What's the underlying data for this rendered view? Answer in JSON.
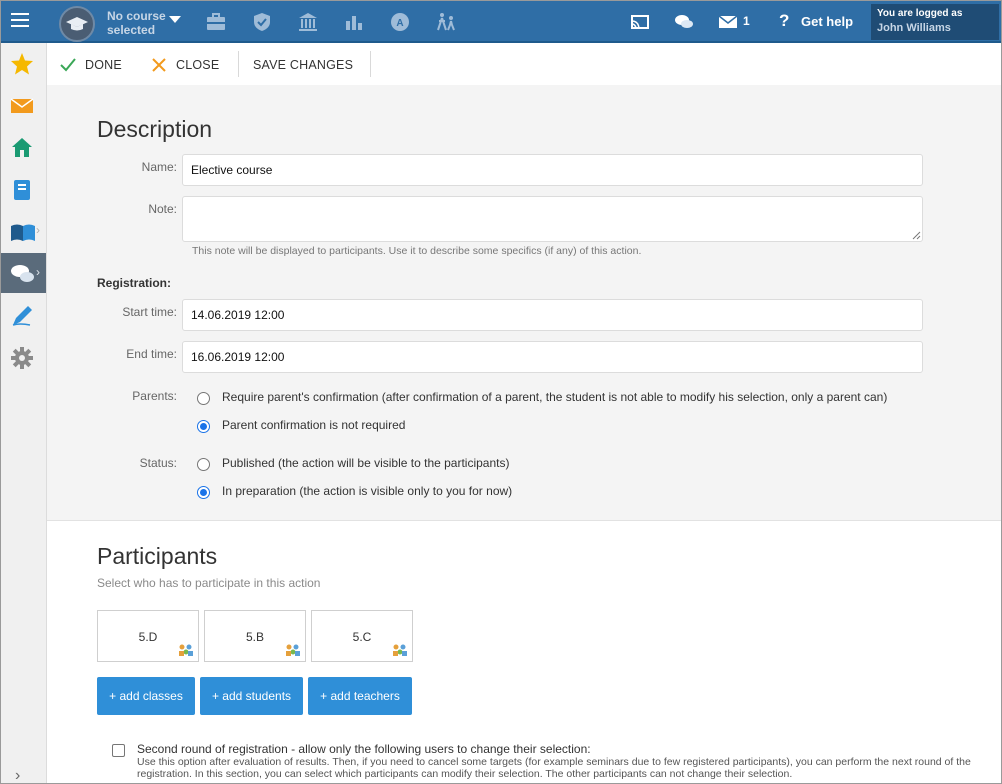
{
  "topbar": {
    "course_line1": "No course",
    "course_line2": "selected",
    "message_count": "1",
    "help_label": "Get help",
    "logged_in_label": "You are logged as",
    "user_name": "John Williams",
    "nav_icons": [
      "briefcase-icon",
      "shield-icon",
      "institution-icon",
      "bar-chart-icon",
      "award-icon",
      "walking-people-icon"
    ],
    "colors": {
      "bar": "#2f6ea6",
      "login_box": "#1f4c75"
    }
  },
  "sidebar": {
    "items": [
      "star-icon",
      "envelope-icon",
      "home-icon",
      "notebook-icon",
      "open-book-icon",
      "chat-icon",
      "pen-icon",
      "gear-icon"
    ]
  },
  "toolbar": {
    "done_label": "DONE",
    "close_label": "CLOSE",
    "save_label": "SAVE CHANGES"
  },
  "description": {
    "title": "Description",
    "name_label": "Name:",
    "name_value": "Elective course",
    "note_label": "Note:",
    "note_value": "",
    "note_hint": "This note will be displayed to participants. Use it to describe some specifics (if any) of this action.",
    "registration_label": "Registration:",
    "start_label": "Start time:",
    "start_value": "14.06.2019 12:00",
    "end_label": "End time:",
    "end_value": "16.06.2019 12:00",
    "parents_label": "Parents:",
    "parents_options": [
      {
        "label": "Require parent's confirmation (after confirmation of a parent, the student is not able to modify his selection, only a parent can)",
        "checked": false
      },
      {
        "label": "Parent confirmation is not required",
        "checked": true
      }
    ],
    "status_label": "Status:",
    "status_options": [
      {
        "label": "Published (the action will be visible to the participants)",
        "checked": false
      },
      {
        "label": "In preparation (the action is visible only to you for now)",
        "checked": true
      }
    ]
  },
  "participants": {
    "title": "Participants",
    "subtitle": "Select who has to participate in this action",
    "classes": [
      "5.D",
      "5.B",
      "5.C"
    ],
    "add_classes": "+ add classes",
    "add_students": "+ add students",
    "add_teachers": "+ add teachers",
    "second_round_label": "Second round of registration - allow only the following users to change their selection:",
    "second_round_checked": false,
    "second_round_line1": "Use this option after evaluation of results. Then, if you need to cancel some targets (for example seminars due to few registered participants), you can perform the next round of the",
    "second_round_line2": "registration. In this section, you can select which participants can modify their selection. The other participants can not change their selection.",
    "accent_color": "#2f8fd8"
  }
}
